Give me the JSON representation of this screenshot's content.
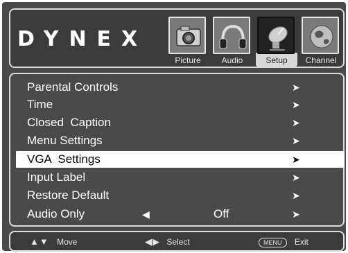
{
  "brand": "DYNEX",
  "tabs": [
    {
      "label": "Picture",
      "icon": "camera-icon",
      "active": false
    },
    {
      "label": "Audio",
      "icon": "headphones-icon",
      "active": false
    },
    {
      "label": "Setup",
      "icon": "satellite-dish-icon",
      "active": true
    },
    {
      "label": "Channel",
      "icon": "globe-icon",
      "active": false
    }
  ],
  "menu": {
    "items": [
      {
        "label": "Parental Controls"
      },
      {
        "label": "Time"
      },
      {
        "label": "Closed  Caption"
      },
      {
        "label": "Menu Settings"
      },
      {
        "label": "VGA  Settings",
        "selected": true
      },
      {
        "label": "Input Label"
      },
      {
        "label": "Restore Default"
      },
      {
        "label": "Audio Only",
        "value": "Off"
      }
    ],
    "arrow_glyph": "➤",
    "left_arrow_glyph": "◀"
  },
  "footer": {
    "move_keys": "▲▼",
    "move_label": "Move",
    "select_keys": "◀▶",
    "select_label": "Select",
    "menu_key": "MENU",
    "exit_label": "Exit"
  },
  "colors": {
    "panel": "#4a4a4a",
    "header": "#3b3b3b",
    "highlight": "#ffffff",
    "border": "#dcdcdc"
  }
}
